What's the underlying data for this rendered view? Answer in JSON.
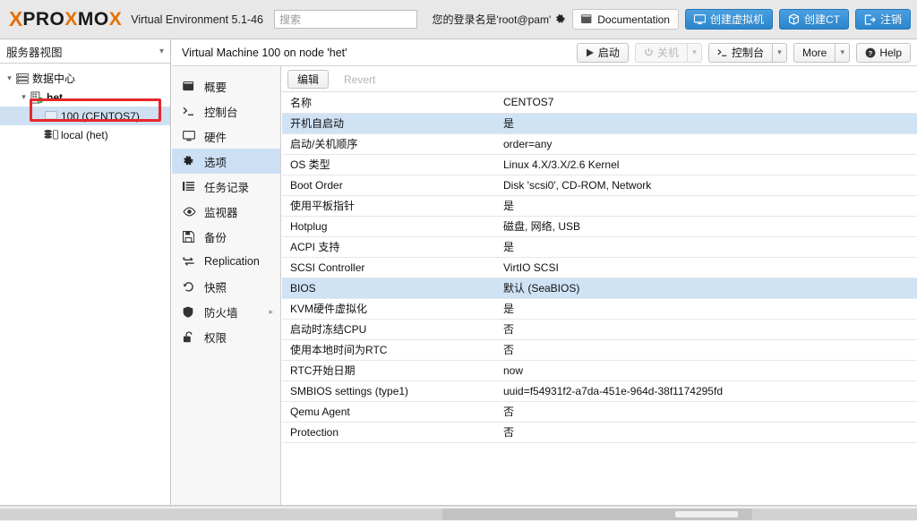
{
  "topbar": {
    "logo_x": "X",
    "logo_text_dark_1": "PRO",
    "logo_text_orange": "X",
    "logo_text_dark_2": "MO",
    "logo_x_end": "X",
    "product_name": "Virtual Environment 5.1-46",
    "search_placeholder": "搜索",
    "search_value": "",
    "login_label": "您的登录名是'root@pam'",
    "documentation_label": "Documentation",
    "create_vm_label": "创建虚拟机",
    "create_ct_label": "创建CT",
    "logout_label": "注销"
  },
  "sidebar": {
    "view_selector": "服务器视图",
    "tree": [
      {
        "label": "数据中心",
        "icon": "datacenter-icon",
        "depth": 0,
        "expanded": true,
        "selected": false,
        "bold": false
      },
      {
        "label": "het",
        "icon": "node-icon",
        "depth": 1,
        "expanded": true,
        "selected": false,
        "bold": true
      },
      {
        "label": "100 (CENTOS7)",
        "icon": "vm-icon",
        "depth": 2,
        "expanded": null,
        "selected": true,
        "bold": false
      },
      {
        "label": "local (het)",
        "icon": "storage-icon",
        "depth": 2,
        "expanded": null,
        "selected": false,
        "bold": false
      }
    ]
  },
  "vm_menu": {
    "items": [
      {
        "label": "概要",
        "icon": "book-icon",
        "selected": false,
        "submenu": false
      },
      {
        "label": "控制台",
        "icon": "terminal-icon",
        "selected": false,
        "submenu": false
      },
      {
        "label": "硬件",
        "icon": "monitor-icon",
        "selected": false,
        "submenu": false
      },
      {
        "label": "选项",
        "icon": "gear-icon",
        "selected": true,
        "submenu": false
      },
      {
        "label": "任务记录",
        "icon": "list-icon",
        "selected": false,
        "submenu": false
      },
      {
        "label": "监视器",
        "icon": "eye-icon",
        "selected": false,
        "submenu": false
      },
      {
        "label": "备份",
        "icon": "save-icon",
        "selected": false,
        "submenu": false
      },
      {
        "label": "Replication",
        "icon": "replication-icon",
        "selected": false,
        "submenu": false
      },
      {
        "label": "快照",
        "icon": "history-icon",
        "selected": false,
        "submenu": false
      },
      {
        "label": "防火墙",
        "icon": "shield-icon",
        "selected": false,
        "submenu": true
      },
      {
        "label": "权限",
        "icon": "unlock-icon",
        "selected": false,
        "submenu": false
      }
    ]
  },
  "content_header": {
    "title": "Virtual Machine 100 on node 'het'",
    "start_label": "启动",
    "shutdown_label": "关机",
    "console_label": "控制台",
    "more_label": "More",
    "help_label": "Help"
  },
  "options": {
    "edit_label": "编辑",
    "revert_label": "Revert",
    "rows": [
      {
        "key": "名称",
        "value": "CENTOS7",
        "highlighted": false
      },
      {
        "key": "开机自启动",
        "value": "是",
        "highlighted": true
      },
      {
        "key": "启动/关机顺序",
        "value": "order=any",
        "highlighted": false
      },
      {
        "key": "OS 类型",
        "value": "Linux 4.X/3.X/2.6 Kernel",
        "highlighted": false
      },
      {
        "key": "Boot Order",
        "value": "Disk 'scsi0', CD-ROM, Network",
        "highlighted": false
      },
      {
        "key": "使用平板指针",
        "value": "是",
        "highlighted": false
      },
      {
        "key": "Hotplug",
        "value": "磁盘, 网络, USB",
        "highlighted": false
      },
      {
        "key": "ACPI 支持",
        "value": "是",
        "highlighted": false
      },
      {
        "key": "SCSI Controller",
        "value": "VirtIO SCSI",
        "highlighted": false
      },
      {
        "key": "BIOS",
        "value": "默认 (SeaBIOS)",
        "highlighted": true
      },
      {
        "key": "KVM硬件虚拟化",
        "value": "是",
        "highlighted": false
      },
      {
        "key": "启动时冻结CPU",
        "value": "否",
        "highlighted": false
      },
      {
        "key": "使用本地时间为RTC",
        "value": "否",
        "highlighted": false
      },
      {
        "key": "RTC开始日期",
        "value": "now",
        "highlighted": false
      },
      {
        "key": "SMBIOS settings (type1)",
        "value": "uuid=f54931f2-a7da-451e-964d-38f1174295fd",
        "highlighted": false
      },
      {
        "key": "Qemu Agent",
        "value": "否",
        "highlighted": false
      },
      {
        "key": "Protection",
        "value": "否",
        "highlighted": false
      }
    ]
  },
  "colors": {
    "accent_blue": "#2b86cc",
    "brand_orange": "#e57000",
    "selection_blue": "#cfe0f2",
    "annotation_red": "#e8262a"
  }
}
